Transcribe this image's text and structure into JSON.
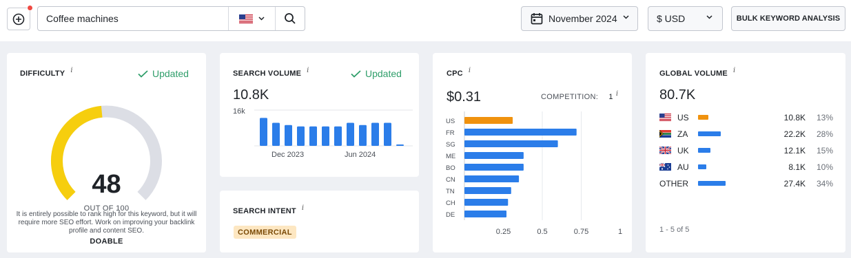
{
  "search": {
    "query": "Coffee machines",
    "country_icon": "us-flag-icon"
  },
  "toolbar": {
    "date_label": "November 2024",
    "currency_label": "$ USD",
    "bulk_label": "BULK KEYWORD ANALYSIS"
  },
  "difficulty": {
    "title": "DIFFICULTY",
    "info": "i",
    "updated": "Updated",
    "value": "48",
    "out_of": "OUT OF 100",
    "level": "DOABLE",
    "description": "It is entirely possible to rank high for this keyword, but it will require more SEO effort. Work on improving your backlink profile and content SEO.",
    "score_fraction": 0.48,
    "colors": {
      "fill": "#f6ce0e",
      "track": "#dcdee5"
    }
  },
  "search_volume": {
    "title": "SEARCH VOLUME",
    "info": "i",
    "updated": "Updated",
    "value": "10.8K",
    "chart_data": {
      "type": "bar",
      "y_tick_label": "16k",
      "ylim": [
        0,
        16000
      ],
      "x_labels": [
        "Dec 2023",
        "Jun 2024"
      ],
      "values": [
        12500,
        10300,
        9300,
        8700,
        8700,
        8700,
        8700,
        10300,
        9300,
        10300,
        10300,
        600
      ],
      "color": "#2b7de9"
    }
  },
  "intent": {
    "title": "SEARCH INTENT",
    "info": "i",
    "badge": "COMMERCIAL"
  },
  "cpc": {
    "title": "CPC",
    "info": "i",
    "value": "$0.31",
    "competition_label": "COMPETITION:",
    "competition_value": "1",
    "competition_info": "i",
    "chart_data": {
      "type": "bar",
      "orientation": "horizontal",
      "categories": [
        "US",
        "FR",
        "SG",
        "ME",
        "BO",
        "CN",
        "TN",
        "CH",
        "DE"
      ],
      "values": [
        0.31,
        0.72,
        0.6,
        0.38,
        0.38,
        0.35,
        0.3,
        0.28,
        0.27
      ],
      "xlim": [
        0,
        1
      ],
      "x_ticks": [
        "0.25",
        "0.5",
        "0.75",
        "1"
      ],
      "highlight_color": "#f0920e",
      "color": "#2b7de9"
    }
  },
  "global_volume": {
    "title": "GLOBAL VOLUME",
    "info": "i",
    "value": "80.7K",
    "rows": [
      {
        "code": "US",
        "flag": "us-flag-icon",
        "volume": "10.8K",
        "percent": "13%",
        "share": 0.13,
        "color": "#f0920e"
      },
      {
        "code": "ZA",
        "flag": "za-flag-icon",
        "volume": "22.2K",
        "percent": "28%",
        "share": 0.28,
        "color": "#2b7de9"
      },
      {
        "code": "UK",
        "flag": "uk-flag-icon",
        "volume": "12.1K",
        "percent": "15%",
        "share": 0.15,
        "color": "#2b7de9"
      },
      {
        "code": "AU",
        "flag": "au-flag-icon",
        "volume": "8.1K",
        "percent": "10%",
        "share": 0.1,
        "color": "#2b7de9"
      },
      {
        "code": "OTHER",
        "flag": "",
        "volume": "27.4K",
        "percent": "34%",
        "share": 0.34,
        "color": "#2b7de9"
      }
    ],
    "pager": "1 - 5 of 5"
  }
}
